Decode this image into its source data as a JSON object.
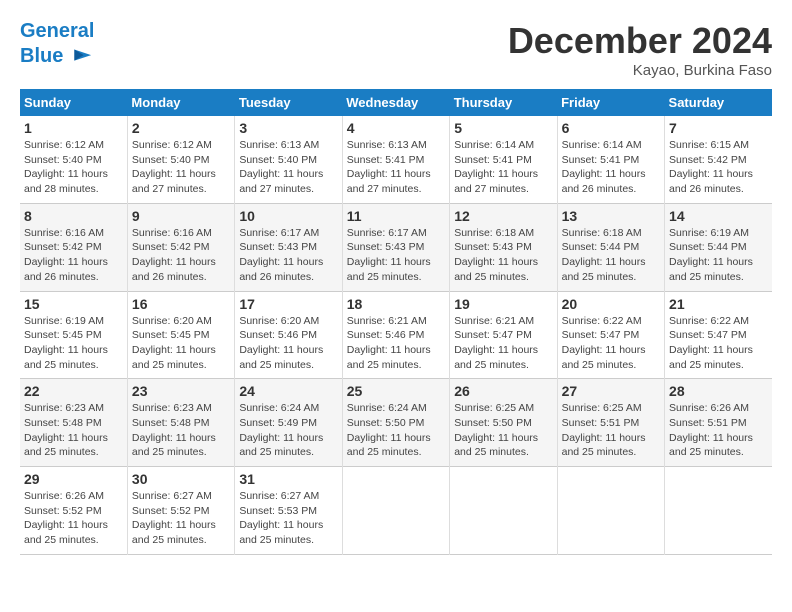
{
  "logo": {
    "line1": "General",
    "line2": "Blue"
  },
  "title": "December 2024",
  "location": "Kayao, Burkina Faso",
  "weekdays": [
    "Sunday",
    "Monday",
    "Tuesday",
    "Wednesday",
    "Thursday",
    "Friday",
    "Saturday"
  ],
  "weeks": [
    [
      {
        "day": "1",
        "sunrise": "6:12 AM",
        "sunset": "5:40 PM",
        "daylight": "11 hours and 28 minutes."
      },
      {
        "day": "2",
        "sunrise": "6:12 AM",
        "sunset": "5:40 PM",
        "daylight": "11 hours and 27 minutes."
      },
      {
        "day": "3",
        "sunrise": "6:13 AM",
        "sunset": "5:40 PM",
        "daylight": "11 hours and 27 minutes."
      },
      {
        "day": "4",
        "sunrise": "6:13 AM",
        "sunset": "5:41 PM",
        "daylight": "11 hours and 27 minutes."
      },
      {
        "day": "5",
        "sunrise": "6:14 AM",
        "sunset": "5:41 PM",
        "daylight": "11 hours and 27 minutes."
      },
      {
        "day": "6",
        "sunrise": "6:14 AM",
        "sunset": "5:41 PM",
        "daylight": "11 hours and 26 minutes."
      },
      {
        "day": "7",
        "sunrise": "6:15 AM",
        "sunset": "5:42 PM",
        "daylight": "11 hours and 26 minutes."
      }
    ],
    [
      {
        "day": "8",
        "sunrise": "6:16 AM",
        "sunset": "5:42 PM",
        "daylight": "11 hours and 26 minutes."
      },
      {
        "day": "9",
        "sunrise": "6:16 AM",
        "sunset": "5:42 PM",
        "daylight": "11 hours and 26 minutes."
      },
      {
        "day": "10",
        "sunrise": "6:17 AM",
        "sunset": "5:43 PM",
        "daylight": "11 hours and 26 minutes."
      },
      {
        "day": "11",
        "sunrise": "6:17 AM",
        "sunset": "5:43 PM",
        "daylight": "11 hours and 25 minutes."
      },
      {
        "day": "12",
        "sunrise": "6:18 AM",
        "sunset": "5:43 PM",
        "daylight": "11 hours and 25 minutes."
      },
      {
        "day": "13",
        "sunrise": "6:18 AM",
        "sunset": "5:44 PM",
        "daylight": "11 hours and 25 minutes."
      },
      {
        "day": "14",
        "sunrise": "6:19 AM",
        "sunset": "5:44 PM",
        "daylight": "11 hours and 25 minutes."
      }
    ],
    [
      {
        "day": "15",
        "sunrise": "6:19 AM",
        "sunset": "5:45 PM",
        "daylight": "11 hours and 25 minutes."
      },
      {
        "day": "16",
        "sunrise": "6:20 AM",
        "sunset": "5:45 PM",
        "daylight": "11 hours and 25 minutes."
      },
      {
        "day": "17",
        "sunrise": "6:20 AM",
        "sunset": "5:46 PM",
        "daylight": "11 hours and 25 minutes."
      },
      {
        "day": "18",
        "sunrise": "6:21 AM",
        "sunset": "5:46 PM",
        "daylight": "11 hours and 25 minutes."
      },
      {
        "day": "19",
        "sunrise": "6:21 AM",
        "sunset": "5:47 PM",
        "daylight": "11 hours and 25 minutes."
      },
      {
        "day": "20",
        "sunrise": "6:22 AM",
        "sunset": "5:47 PM",
        "daylight": "11 hours and 25 minutes."
      },
      {
        "day": "21",
        "sunrise": "6:22 AM",
        "sunset": "5:47 PM",
        "daylight": "11 hours and 25 minutes."
      }
    ],
    [
      {
        "day": "22",
        "sunrise": "6:23 AM",
        "sunset": "5:48 PM",
        "daylight": "11 hours and 25 minutes."
      },
      {
        "day": "23",
        "sunrise": "6:23 AM",
        "sunset": "5:48 PM",
        "daylight": "11 hours and 25 minutes."
      },
      {
        "day": "24",
        "sunrise": "6:24 AM",
        "sunset": "5:49 PM",
        "daylight": "11 hours and 25 minutes."
      },
      {
        "day": "25",
        "sunrise": "6:24 AM",
        "sunset": "5:50 PM",
        "daylight": "11 hours and 25 minutes."
      },
      {
        "day": "26",
        "sunrise": "6:25 AM",
        "sunset": "5:50 PM",
        "daylight": "11 hours and 25 minutes."
      },
      {
        "day": "27",
        "sunrise": "6:25 AM",
        "sunset": "5:51 PM",
        "daylight": "11 hours and 25 minutes."
      },
      {
        "day": "28",
        "sunrise": "6:26 AM",
        "sunset": "5:51 PM",
        "daylight": "11 hours and 25 minutes."
      }
    ],
    [
      {
        "day": "29",
        "sunrise": "6:26 AM",
        "sunset": "5:52 PM",
        "daylight": "11 hours and 25 minutes."
      },
      {
        "day": "30",
        "sunrise": "6:27 AM",
        "sunset": "5:52 PM",
        "daylight": "11 hours and 25 minutes."
      },
      {
        "day": "31",
        "sunrise": "6:27 AM",
        "sunset": "5:53 PM",
        "daylight": "11 hours and 25 minutes."
      },
      null,
      null,
      null,
      null
    ]
  ]
}
